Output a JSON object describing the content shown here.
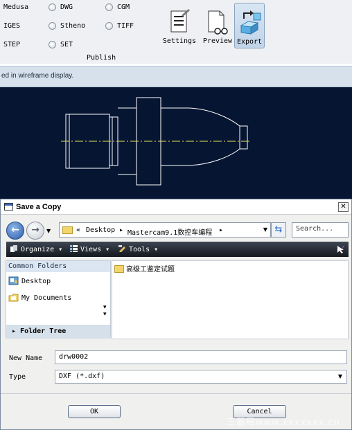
{
  "publish": {
    "formats_col1": [
      "Medusa",
      "IGES",
      "STEP"
    ],
    "formats_col2": [
      "DWG",
      "Stheno",
      "SET"
    ],
    "formats_col3": [
      "CGM",
      "TIFF"
    ],
    "group_label": "Publish",
    "buttons": {
      "settings": "Settings",
      "preview": "Preview",
      "export": "Export"
    }
  },
  "status_message": "ed in wireframe display.",
  "dialog": {
    "title": "Save a Copy",
    "close_glyph": "✕",
    "address": {
      "prefix": "«",
      "parts": [
        "Desktop",
        "Mastercam9.1数控车编程"
      ],
      "sep": "▸"
    },
    "search_placeholder": "Search...",
    "toolbar": {
      "organize": "Organize",
      "views": "Views",
      "tools": "Tools"
    },
    "common_folders_label": "Common Folders",
    "places": [
      "Desktop",
      "My Documents"
    ],
    "folder_tree_label": "Folder Tree",
    "files": [
      "高级工鉴定试题"
    ],
    "new_name_label": "New Name",
    "new_name_value": "drw0002",
    "type_label": "Type",
    "type_value": "DXF (*.dxf)",
    "ok_label": "OK",
    "cancel_label": "Cancel"
  },
  "watermark": "三菱局www.xxxxxxx.cn",
  "colors": {
    "viewport_bg": "#061532",
    "part_line": "#ffffff",
    "centerline": "#e8e85a",
    "accent": "#2c5ea8"
  }
}
